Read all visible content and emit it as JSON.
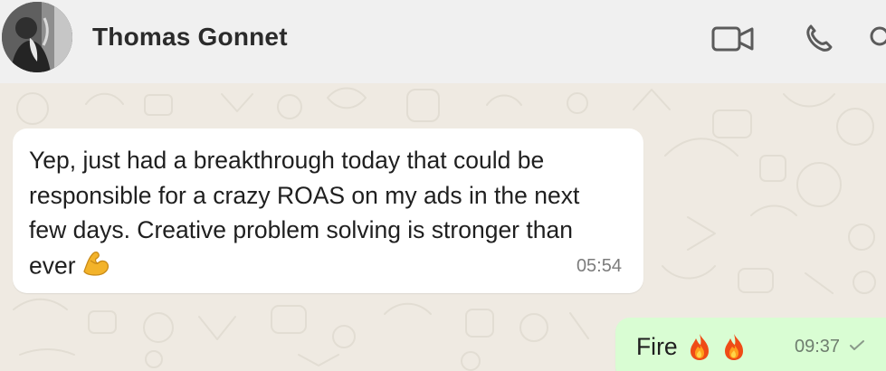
{
  "header": {
    "contact_name": "Thomas Gonnet",
    "icons": [
      "avatar",
      "video-call-icon",
      "voice-call-icon",
      "search-icon"
    ]
  },
  "messages": [
    {
      "direction": "incoming",
      "text": "Yep, just had a breakthrough today that could be responsible for a crazy ROAS on my ads in the next few days. Creative problem solving is stronger than ever",
      "emoji": "flexed-biceps",
      "time": "05:54"
    },
    {
      "direction": "outgoing",
      "text": "Fire",
      "emojis": [
        "fire",
        "fire"
      ],
      "time": "09:37",
      "status": "sent"
    }
  ],
  "colors": {
    "header_bg": "#f0f0f0",
    "chat_bg": "#efeae2",
    "incoming_bubble": "#ffffff",
    "outgoing_bubble": "#d9fdd3",
    "timestamp": "#7c7c7c"
  }
}
